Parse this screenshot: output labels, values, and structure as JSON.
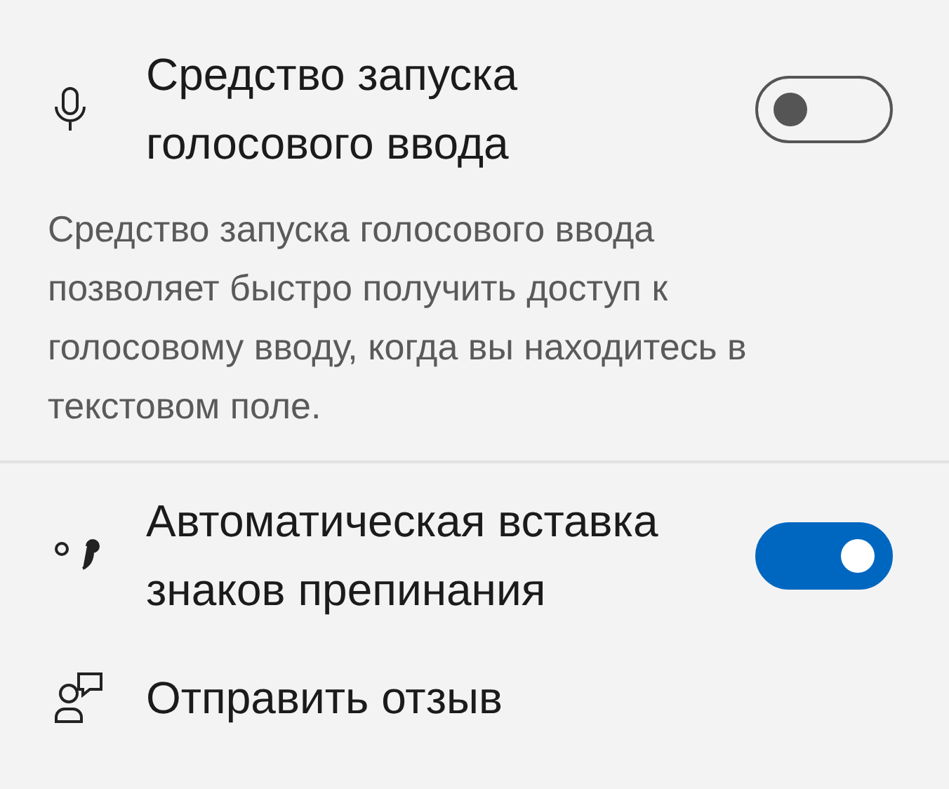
{
  "settings": [
    {
      "kind": "toggle",
      "title": "Средство запуска голосового ввода",
      "on": false,
      "description": "Средство запуска голосового ввода позволяет быстро получить доступ к голосовому вводу, когда вы находитесь в текстовом поле."
    },
    {
      "kind": "toggle",
      "title": "Автоматическая вставка знаков препинания",
      "on": true
    },
    {
      "kind": "link",
      "title": "Отправить отзыв"
    }
  ]
}
